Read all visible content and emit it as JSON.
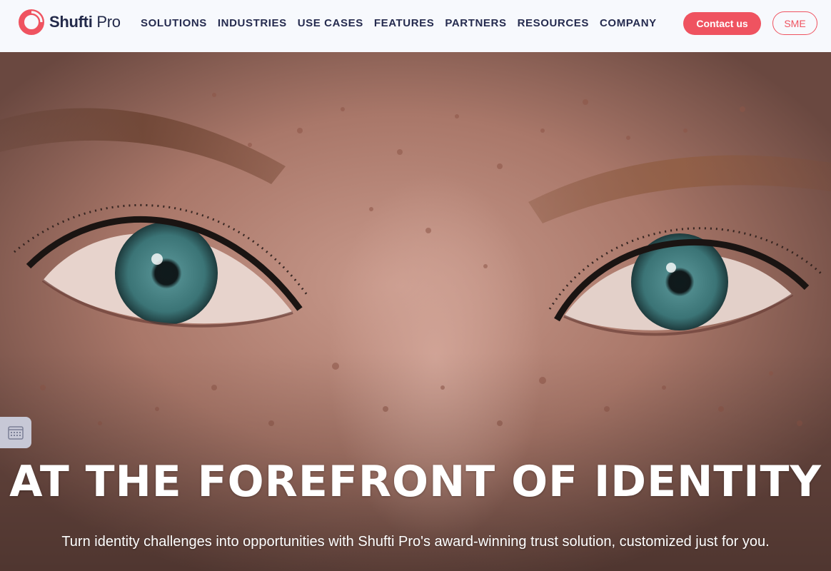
{
  "brand": {
    "name_bold": "Shufti",
    "name_light": " Pro",
    "accent_color": "#ef5360",
    "text_color": "#232a4a"
  },
  "nav": {
    "items": [
      {
        "label": "SOLUTIONS"
      },
      {
        "label": "INDUSTRIES"
      },
      {
        "label": "USE CASES"
      },
      {
        "label": "FEATURES"
      },
      {
        "label": "PARTNERS"
      },
      {
        "label": "RESOURCES"
      },
      {
        "label": "COMPANY"
      }
    ]
  },
  "actions": {
    "contact_label": "Contact us",
    "sme_label": "SME"
  },
  "hero": {
    "title": "AT THE FOREFRONT OF IDENTITY",
    "subtitle": "Turn identity challenges into opportunities with Shufti Pro's award-winning trust solution, customized just for you.",
    "image_subject": "close-up-eyes-photo"
  },
  "side_tab": {
    "icon": "calendar-icon"
  }
}
